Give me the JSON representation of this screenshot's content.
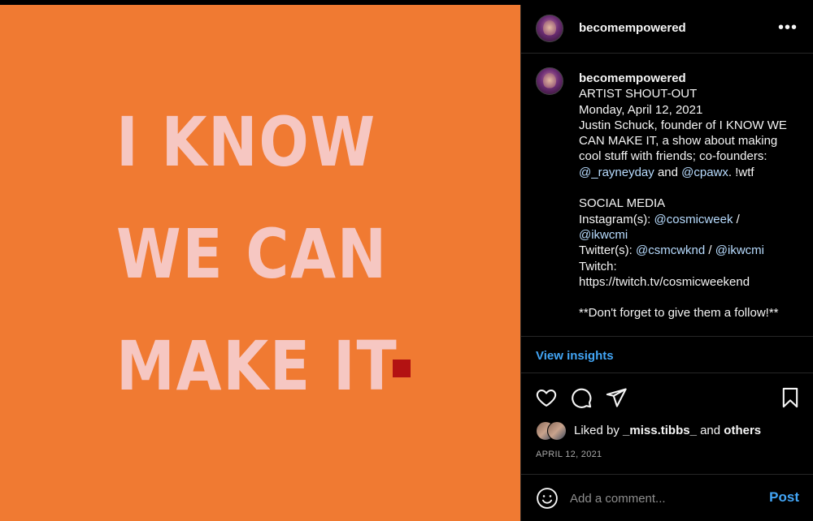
{
  "media": {
    "lines": [
      "I KNOW",
      "WE CAN",
      "MAKE IT"
    ],
    "background_color": "#f07a32",
    "text_color": "#f6c7c2",
    "accent_color": "#b31212"
  },
  "post": {
    "username": "becomempowered",
    "more_icon": "more-horizontal-icon",
    "caption_username": "becomempowered",
    "caption": {
      "l1": "ARTIST SHOUT-OUT",
      "l2": "Monday, April 12, 2021",
      "l3": "Justin Schuck, founder of I KNOW WE",
      "l4": "CAN MAKE IT, a show about making",
      "l5": "cool stuff with friends; co-founders:",
      "l6_m1": "@_rayneyday",
      "l6_and": " and ",
      "l6_m2": "@cpawx",
      "l6_tail": ". !wtf",
      "l8": "SOCIAL MEDIA",
      "l9_label": "Instagram(s): ",
      "l9_m1": "@cosmicweek",
      "l9_sep": " /",
      "l10_m": "@ikwcmi",
      "l11_label": "Twitter(s): ",
      "l11_m1": "@csmcwknd",
      "l11_sep": " / ",
      "l11_m2": "@ikwcmi",
      "l12": "Twitch:",
      "l13": "https://twitch.tv/cosmicweekend",
      "l15": "**Don't forget to give them a follow!**"
    },
    "insights_label": "View insights",
    "likes": {
      "prefix": "Liked by ",
      "user": "_miss.tibbs_",
      "and": " and ",
      "others": "others"
    },
    "date": "APRIL 12, 2021",
    "comment_placeholder": "Add a comment...",
    "post_label": "Post"
  },
  "colors": {
    "link_blue": "#42a5f5",
    "muted": "#a8a8a8",
    "divider": "#262626"
  }
}
